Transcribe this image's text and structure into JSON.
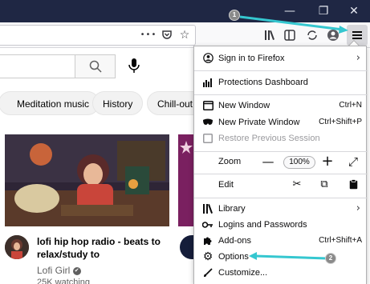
{
  "colors": {
    "titlebar": "#1f2744",
    "accent_arrow": "#35c7d0",
    "hover": "#e6f4fb"
  },
  "window": {
    "minimize": "—",
    "restore": "❐",
    "close": "✕"
  },
  "toolbar": {
    "more_icon": "•••",
    "pocket_icon": "pocket-icon",
    "bookmark_icon": "star-icon",
    "library_icon": "library-icon",
    "sidebar_icon": "sidebar-icon",
    "account_icon": "account-icon",
    "menu_icon": "hamburger-menu-icon"
  },
  "youtube": {
    "chips": [
      "Meditation music",
      "History",
      "Chill-out m"
    ],
    "video": {
      "title": "lofi hip hop radio - beats to relax/study to",
      "channel": "Lofi Girl",
      "verified": "✔",
      "meta": "25K watching"
    }
  },
  "menu": {
    "sign_in": "Sign in to Firefox",
    "protections": "Protections Dashboard",
    "new_window": {
      "label": "New Window",
      "shortcut": "Ctrl+N"
    },
    "new_private": {
      "label": "New Private Window",
      "shortcut": "Ctrl+Shift+P"
    },
    "restore": "Restore Previous Session",
    "zoom": {
      "label": "Zoom",
      "minus": "—",
      "value": "100%",
      "plus": "+",
      "fullscreen": "⤢"
    },
    "edit": {
      "label": "Edit",
      "cut": "✂",
      "copy": "⧉",
      "paste": "📋"
    },
    "library": "Library",
    "logins": "Logins and Passwords",
    "addons": {
      "label": "Add-ons",
      "shortcut": "Ctrl+Shift+A"
    },
    "options": "Options",
    "customize": "Customize..."
  },
  "annotations": {
    "step1": "1",
    "step2": "2"
  }
}
